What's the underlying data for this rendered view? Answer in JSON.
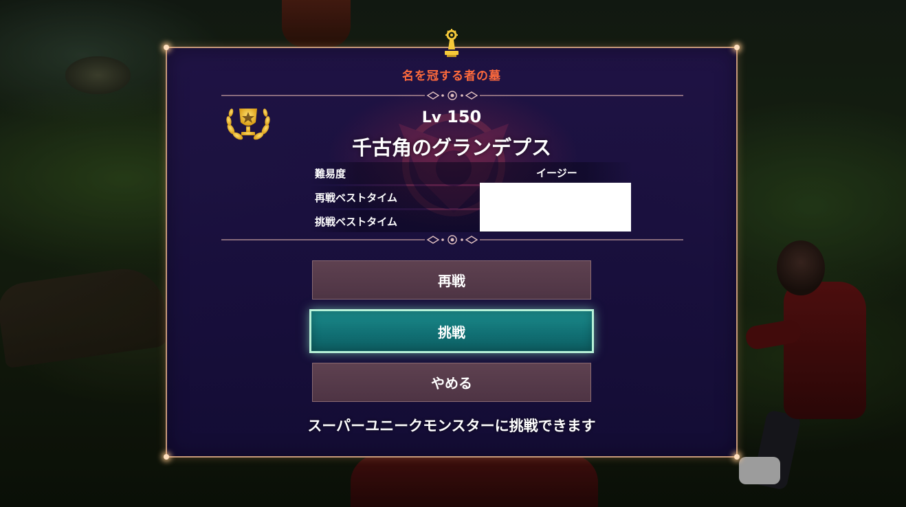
{
  "dialog": {
    "location": "名を冠する者の墓",
    "level_prefix": "Lv",
    "level": "150",
    "monster_name": "千古角のグランデプス",
    "info": [
      {
        "label": "難易度",
        "value": "イージー"
      },
      {
        "label": "再戦ベストタイム",
        "value": ""
      },
      {
        "label": "挑戦ベストタイム",
        "value": ""
      }
    ],
    "buttons": {
      "rematch": "再戦",
      "challenge": "挑戦",
      "quit": "やめる"
    },
    "message": "スーパーユニークモンスターに挑戦できます",
    "selected_button": "challenge"
  },
  "colors": {
    "location_text": "#ff6a3c",
    "panel_border": "#c89a7a",
    "panel_bg": "#201248",
    "button_bg": "#5e4150",
    "button_selected": "#1b8a8a",
    "button_selected_border": "#b8f2d8",
    "trophy_gold": "#f2c230"
  },
  "icons": {
    "top": "pedestal-emblem-icon",
    "trophy": "laurel-trophy-icon",
    "divider": "ornament-divider"
  }
}
